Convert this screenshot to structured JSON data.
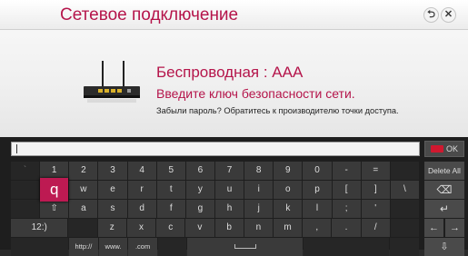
{
  "dialog": {
    "title": "Сетевое подключение",
    "back_icon": "back-arrow-icon",
    "close_icon": "close-icon",
    "network_name": "Беспроводная : AAA",
    "instruction": "Введите ключ безопасности сети.",
    "hint": "Забыли пароль? Обратитесь к производителю точки доступа."
  },
  "keyboard": {
    "input_value": "",
    "ok_label": "OK",
    "rows": {
      "row1": [
        "`",
        "1",
        "2",
        "3",
        "4",
        "5",
        "6",
        "7",
        "8",
        "9",
        "0",
        "-",
        "=",
        ""
      ],
      "row2": [
        "",
        "q",
        "w",
        "e",
        "r",
        "t",
        "y",
        "u",
        "i",
        "o",
        "p",
        "[",
        "]",
        "\\"
      ],
      "row3": [
        "",
        "⇧",
        "a",
        "s",
        "d",
        "f",
        "g",
        "h",
        "j",
        "k",
        "l",
        ";",
        "'",
        ""
      ],
      "row4": [
        "",
        "12:)",
        "",
        "z",
        "x",
        "c",
        "v",
        "b",
        "n",
        "m",
        ",",
        ".",
        "/",
        ""
      ],
      "row5": [
        "",
        "http://",
        "www.",
        ".com",
        "",
        "",
        ""
      ]
    },
    "side": {
      "delete_all": "Delete All",
      "backspace": "⌫",
      "enter": "↵",
      "left": "←",
      "right": "→",
      "down": "⇩"
    },
    "highlighted_key": "q",
    "accent_color": "#b5154b"
  }
}
